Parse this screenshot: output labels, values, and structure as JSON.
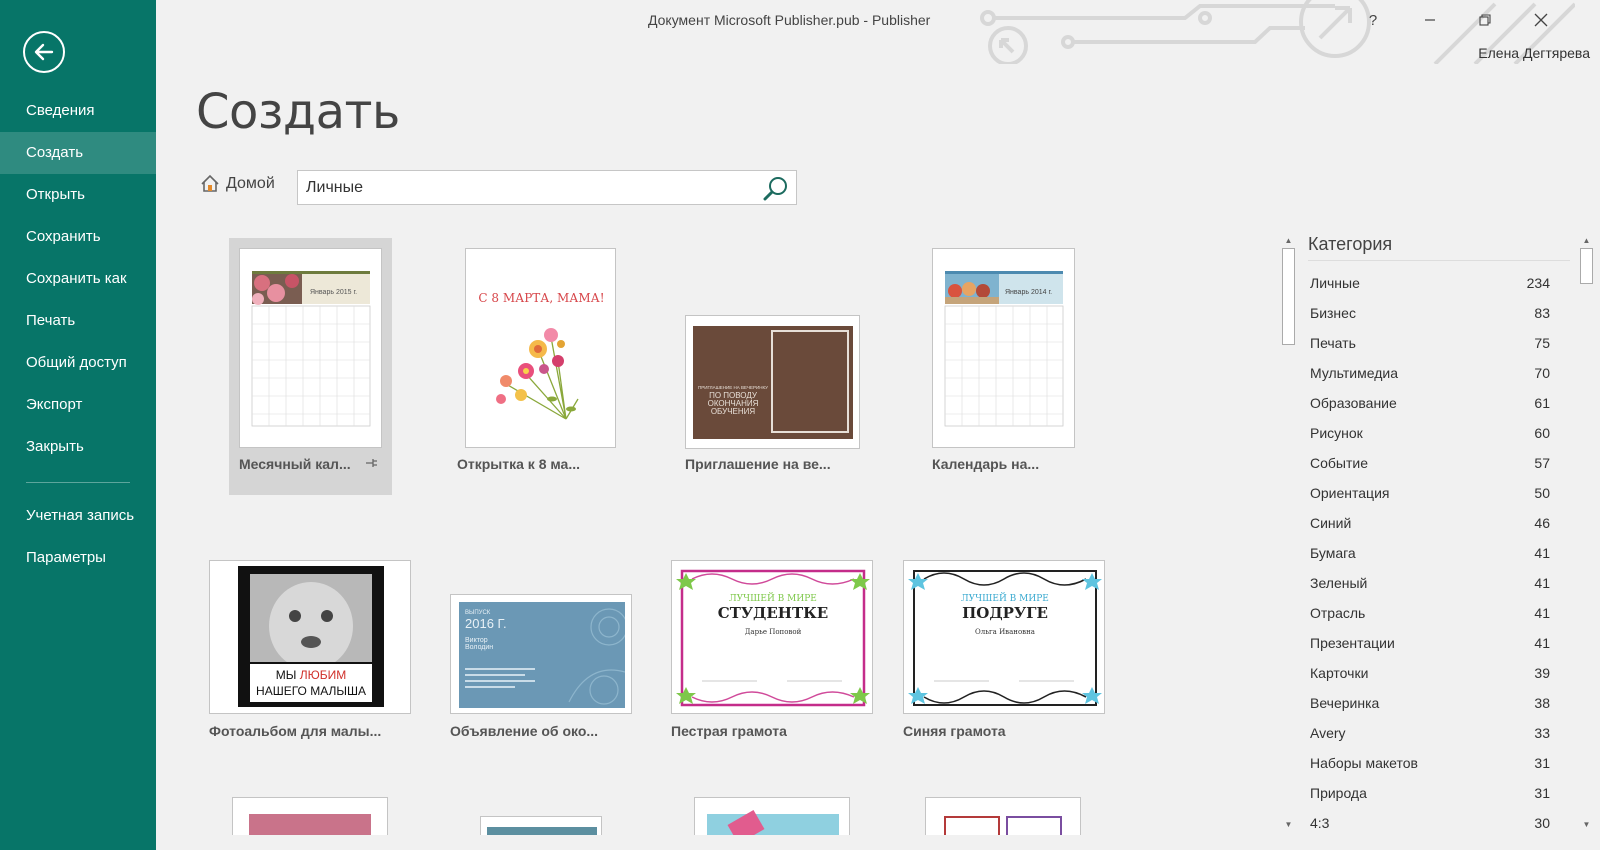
{
  "window": {
    "title": "Документ Microsoft Publisher.pub - Publisher",
    "help_label": "?",
    "user_name": "Елена Дегтярева"
  },
  "sidebar": {
    "items": [
      {
        "label": "Сведения"
      },
      {
        "label": "Создать"
      },
      {
        "label": "Открыть"
      },
      {
        "label": "Сохранить"
      },
      {
        "label": "Сохранить как"
      },
      {
        "label": "Печать"
      },
      {
        "label": "Общий доступ"
      },
      {
        "label": "Экспорт"
      },
      {
        "label": "Закрыть"
      }
    ],
    "bottom_items": [
      {
        "label": "Учетная запись"
      },
      {
        "label": "Параметры"
      }
    ],
    "active": "Создать"
  },
  "main": {
    "title": "Создать",
    "home_label": "Домой",
    "search": {
      "value": "Личные"
    }
  },
  "templates": [
    {
      "label": "Месячный кал...",
      "thumb": {
        "header_text": "Январь 2015 г."
      }
    },
    {
      "label": "Открытка к 8 ма...",
      "thumb": {
        "text": "С 8 МАРТА, МАМА!"
      }
    },
    {
      "label": "Приглашение на ве...",
      "thumb": {
        "lines": [
          "ПРИГЛАШЕНИЕ НА ВЕЧЕРИНКУ",
          "ПО ПОВОДУ",
          "ОКОНЧАНИЯ",
          "ОБУЧЕНИЯ"
        ]
      }
    },
    {
      "label": "Календарь на...",
      "thumb": {
        "header_text": "Январь 2014 г."
      }
    },
    {
      "label": "Фотоальбом для малы...",
      "thumb": {
        "line1_a": "МЫ ",
        "line1_b": "ЛЮБИМ",
        "line2": "НАШЕГО МАЛЫША"
      }
    },
    {
      "label": "Объявление об око...",
      "thumb": {
        "line1": "ВЫПУСК",
        "line2": "2016 Г.",
        "line3": "Виктор",
        "line4": "Володин"
      }
    },
    {
      "label": "Пестрая грамота",
      "thumb": {
        "line1": "ЛУЧШЕЙ В МИРЕ",
        "line2": "СТУДЕНТКЕ",
        "line3": "Дарье Поповой"
      }
    },
    {
      "label": "Синяя грамота",
      "thumb": {
        "line1": "ЛУЧШЕЙ В МИРЕ",
        "line2": "ПОДРУГЕ",
        "line3": "Ольга Ивановна"
      }
    }
  ],
  "categories": {
    "title": "Категория",
    "items": [
      {
        "name": "Личные",
        "count": "234"
      },
      {
        "name": "Бизнес",
        "count": "83"
      },
      {
        "name": "Печать",
        "count": "75"
      },
      {
        "name": "Мультимедиа",
        "count": "70"
      },
      {
        "name": "Образование",
        "count": "61"
      },
      {
        "name": "Рисунок",
        "count": "60"
      },
      {
        "name": "Событие",
        "count": "57"
      },
      {
        "name": "Ориентация",
        "count": "50"
      },
      {
        "name": "Синий",
        "count": "46"
      },
      {
        "name": "Бумага",
        "count": "41"
      },
      {
        "name": "Зеленый",
        "count": "41"
      },
      {
        "name": "Отрасль",
        "count": "41"
      },
      {
        "name": "Презентации",
        "count": "41"
      },
      {
        "name": "Карточки",
        "count": "39"
      },
      {
        "name": "Вечеринка",
        "count": "38"
      },
      {
        "name": "Avery",
        "count": "33"
      },
      {
        "name": "Наборы макетов",
        "count": "31"
      },
      {
        "name": "Природа",
        "count": "31"
      },
      {
        "name": "4:3",
        "count": "30"
      }
    ]
  },
  "colors": {
    "sidebar_bg": "#077568",
    "sidebar_active": "#2f8b80",
    "page_bg": "#f1f1f1"
  }
}
